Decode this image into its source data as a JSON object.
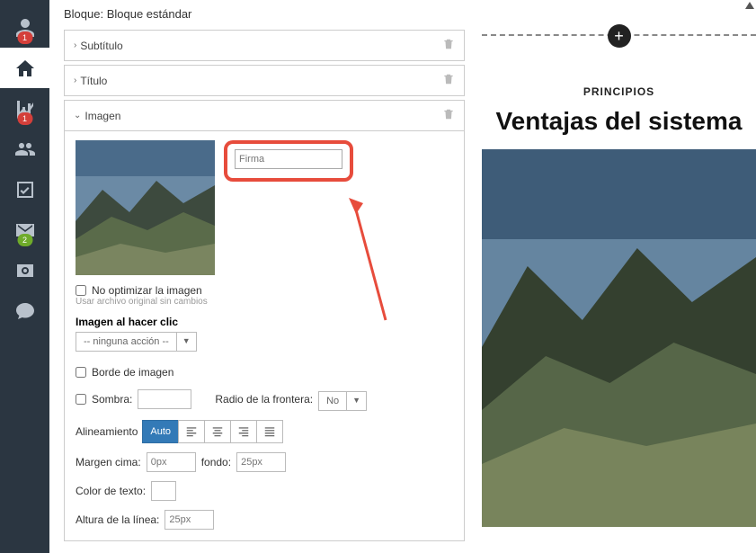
{
  "sidebar": {
    "badges": {
      "profile": "1",
      "chart": "1",
      "mail": "2"
    }
  },
  "panel": {
    "header": "Bloque: Bloque estándar",
    "sections": {
      "subtitulo": "Subtítulo",
      "titulo": "Título",
      "imagen": "Imagen"
    },
    "firma_placeholder": "Firma",
    "no_opt_label": "No optimizar la imagen",
    "no_opt_hint": "Usar archivo original sin cambios",
    "click_label": "Imagen al hacer clic",
    "click_value": "-- ninguna acción --",
    "borde_label": "Borde de imagen",
    "sombra_label": "Sombra:",
    "radio_label": "Radio de la frontera:",
    "radio_value": "No",
    "align_label": "Alineamiento",
    "align_auto": "Auto",
    "margen_cima_label": "Margen cima:",
    "margen_cima_value": "0px",
    "fondo_label": "fondo:",
    "fondo_value": "25px",
    "color_label": "Color de texto:",
    "altura_label": "Altura de la línea:",
    "altura_value": "25px"
  },
  "preview": {
    "subtitle": "PRINCIPIOS",
    "title": "Ventajas del sistema"
  }
}
